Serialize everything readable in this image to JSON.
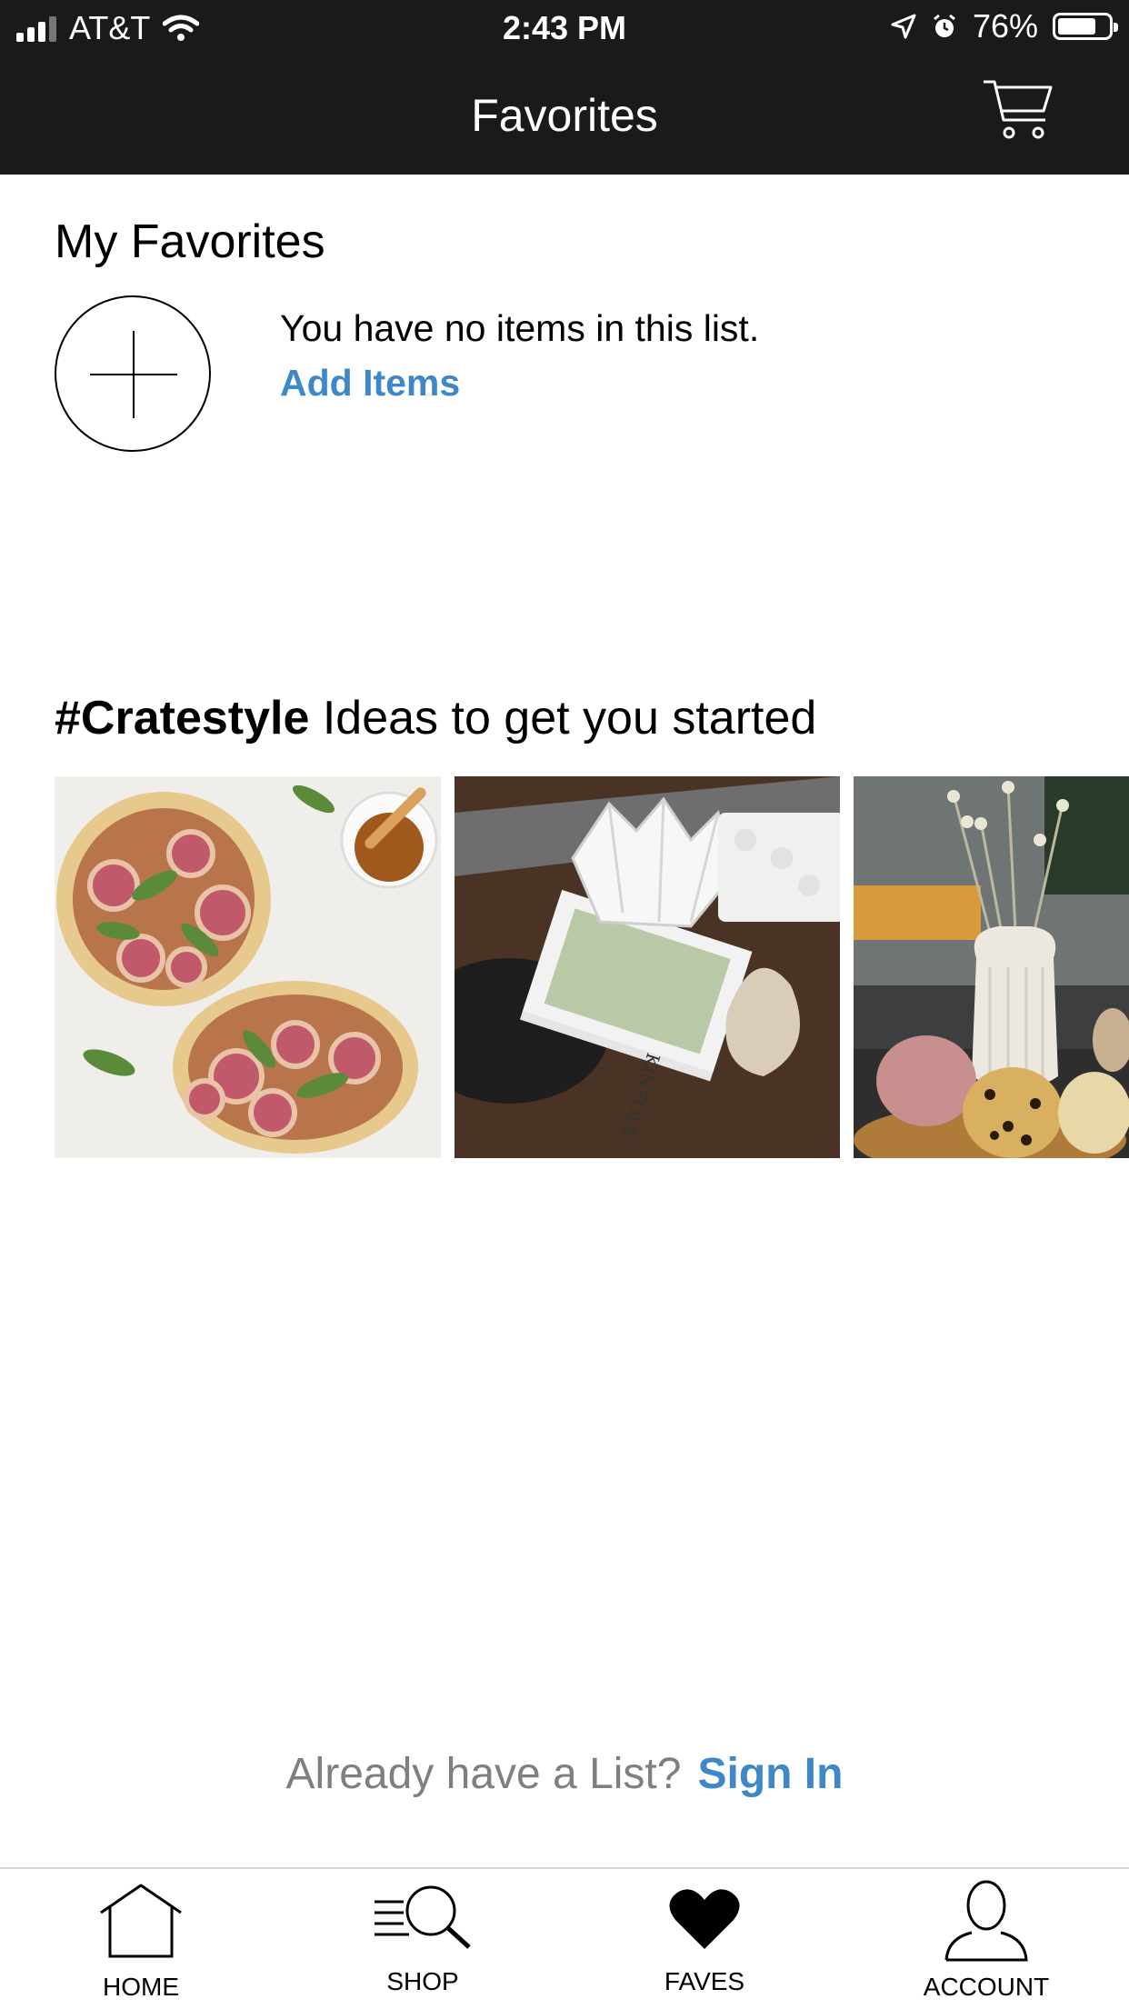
{
  "status_bar": {
    "carrier": "AT&T",
    "time": "2:43 PM",
    "battery_percent": "76%",
    "battery_level": 0.76,
    "icons": [
      "signal-icon",
      "wifi-icon",
      "location-icon",
      "alarm-icon",
      "battery-icon"
    ]
  },
  "header": {
    "title": "Favorites",
    "cart_icon": "cart-icon"
  },
  "favorites": {
    "section_title": "My Favorites",
    "empty_message": "You have no items in this list.",
    "add_items_label": "Add Items",
    "add_icon": "plus-circle-icon"
  },
  "ideas": {
    "hashtag": "#Cratestyle",
    "title_rest": " Ideas to get you started",
    "images": [
      {
        "name": "fig-flatbread-image"
      },
      {
        "name": "vase-books-table-image",
        "visible_text": "KINFOLK"
      },
      {
        "name": "vase-pumpkins-image"
      }
    ]
  },
  "signin": {
    "question": "Already have a List?",
    "link_label": "Sign In"
  },
  "tabbar": {
    "items": [
      {
        "label": "HOME",
        "icon": "home-icon"
      },
      {
        "label": "SHOP",
        "icon": "shop-search-icon"
      },
      {
        "label": "FAVES",
        "icon": "heart-icon",
        "active": true
      },
      {
        "label": "ACCOUNT",
        "icon": "account-icon"
      }
    ]
  },
  "colors": {
    "header_bg": "#1a1a1a",
    "link_blue": "#3e87c8",
    "muted_text": "#7f7f7f"
  }
}
